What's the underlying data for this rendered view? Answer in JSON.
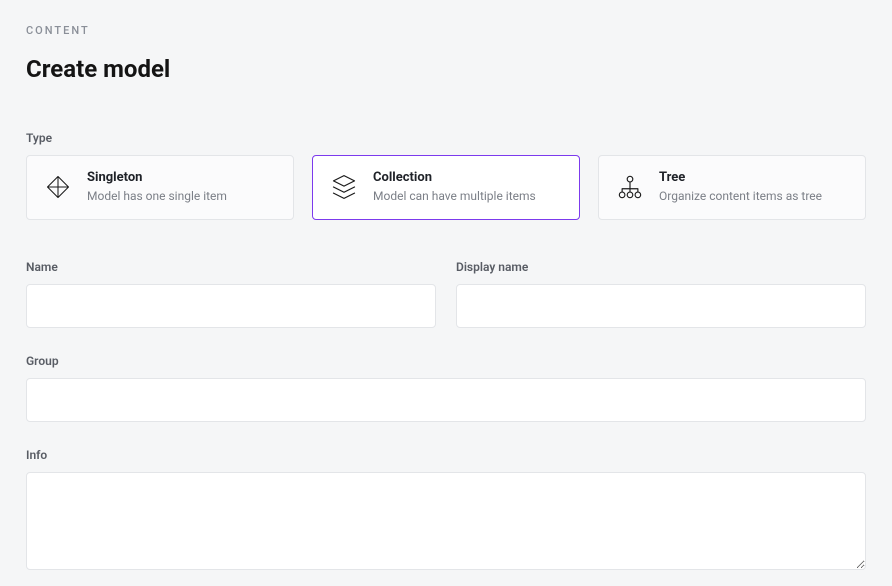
{
  "breadcrumb": "CONTENT",
  "page_title": "Create model",
  "type": {
    "label": "Type",
    "options": [
      {
        "title": "Singleton",
        "desc": "Model has one single item",
        "selected": false
      },
      {
        "title": "Collection",
        "desc": "Model can have multiple items",
        "selected": true
      },
      {
        "title": "Tree",
        "desc": "Organize content items as tree",
        "selected": false
      }
    ]
  },
  "fields": {
    "name": {
      "label": "Name",
      "value": ""
    },
    "display_name": {
      "label": "Display name",
      "value": ""
    },
    "group": {
      "label": "Group",
      "value": ""
    },
    "info": {
      "label": "Info",
      "value": ""
    }
  }
}
